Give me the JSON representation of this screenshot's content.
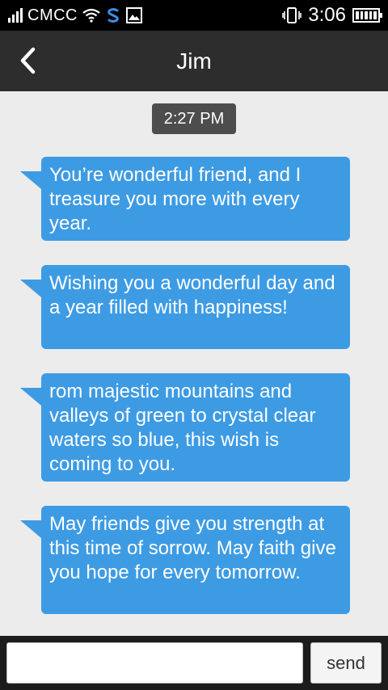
{
  "status_bar": {
    "carrier": "CMCC",
    "time": "3:06",
    "icons": [
      "signal-icon",
      "wifi-icon",
      "s-app-icon",
      "image-icon",
      "vibrate-icon",
      "battery-icon"
    ]
  },
  "header": {
    "title": "Jim",
    "back_icon": "chevron-left-icon"
  },
  "conversation": {
    "timestamp": "2:27 PM",
    "messages": [
      {
        "text": "You’re wonderful friend, and I treasure you more with every year."
      },
      {
        "text": "Wishing you a wonderful day and a year filled with happiness!"
      },
      {
        "text": "rom majestic mountains and valleys of green to crystal clear waters so blue, this wish is coming to you."
      },
      {
        "text": "May friends give you strength at this time of sorrow. May faith give you hope for every tomorrow."
      }
    ]
  },
  "composer": {
    "input_value": "",
    "input_placeholder": "",
    "send_label": "send"
  },
  "colors": {
    "bubble": "#3d9be4",
    "header": "#2d2d2d",
    "background": "#ececec"
  }
}
